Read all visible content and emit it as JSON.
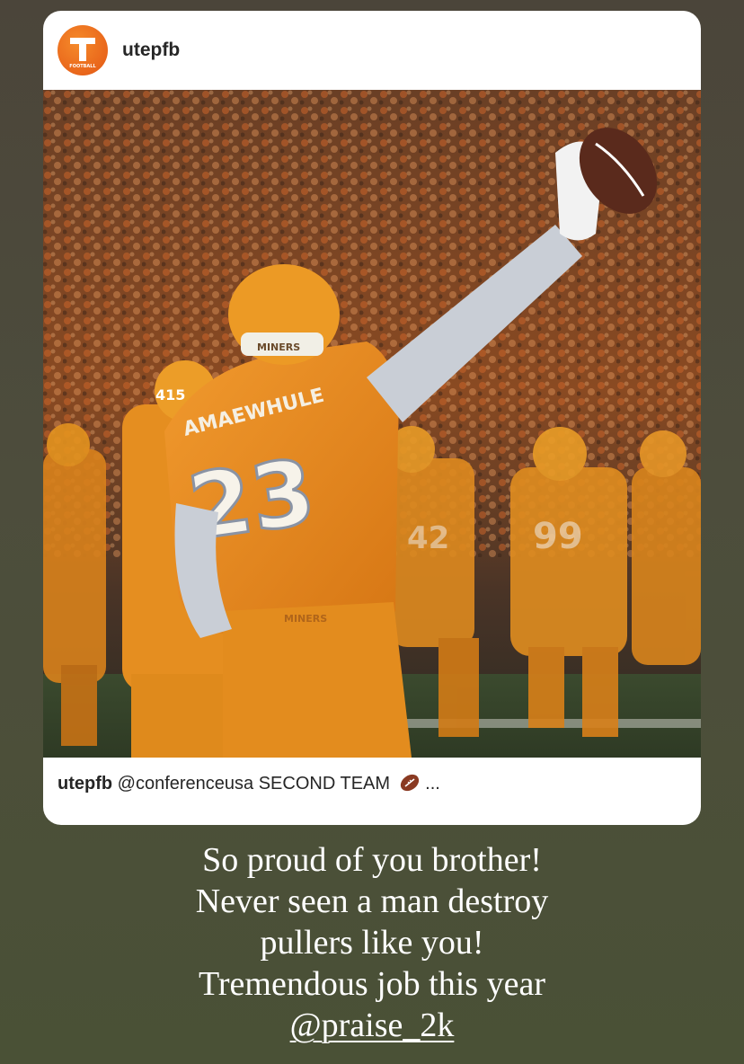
{
  "post": {
    "avatar_icon": "utep-football-logo-icon",
    "avatar_text": "FOOTBALL",
    "username": "utepfb",
    "image_icon": "football-player-celebration-photo",
    "caption": {
      "username": "utepfb",
      "text": "@conferenceusa SECOND TEAM",
      "emoji_icon": "american-football-emoji-icon",
      "ellipsis": "..."
    }
  },
  "story_text": {
    "lines": [
      "So proud of you brother!",
      "Never seen a man destroy",
      "pullers like you!",
      "Tremendous job this year"
    ],
    "mention": "@praise_2k"
  },
  "colors": {
    "background_top": "#4b453a",
    "background_bottom": "#4a5136",
    "card": "#ffffff",
    "accent_orange": "#e9661b",
    "text_white": "#ffffff"
  }
}
